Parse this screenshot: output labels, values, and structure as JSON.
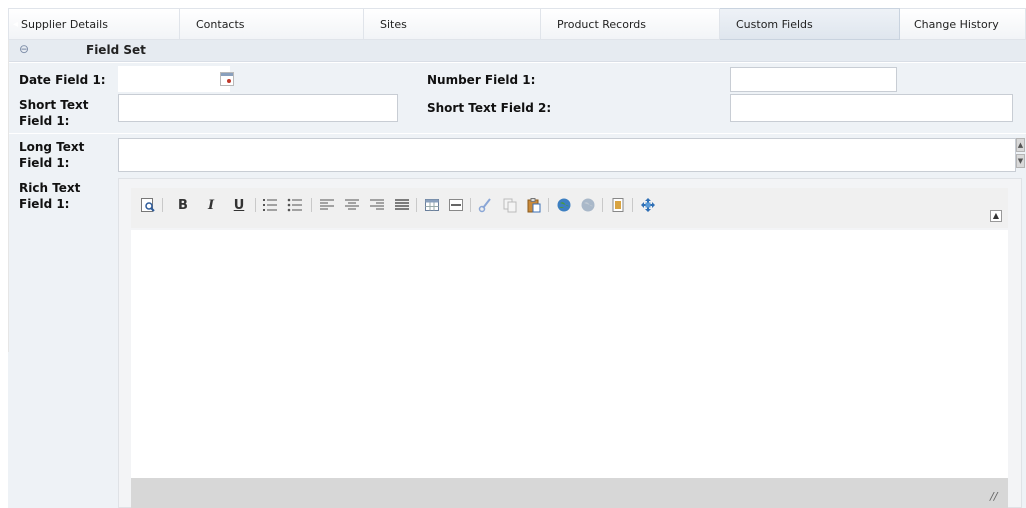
{
  "tabs": [
    {
      "label": "Supplier Details",
      "active": false
    },
    {
      "label": "Contacts",
      "active": false
    },
    {
      "label": "Sites",
      "active": false
    },
    {
      "label": "Product Records",
      "active": false
    },
    {
      "label": "Custom Fields",
      "active": true
    },
    {
      "label": "Change History",
      "active": false
    }
  ],
  "field_set": {
    "title": "Field Set"
  },
  "fields": {
    "date_field_1": {
      "label": "Date Field 1:",
      "value": ""
    },
    "number_field_1": {
      "label": "Number Field 1:",
      "value": ""
    },
    "short_text_field_1": {
      "label": "Short Text Field 1:",
      "value": ""
    },
    "short_text_field_2": {
      "label": "Short Text Field 2:",
      "value": ""
    },
    "long_text_field_1": {
      "label": "Long Text Field 1:",
      "value": ""
    },
    "rich_text_field_1": {
      "label": "Rich Text Field 1:",
      "value": ""
    }
  },
  "rte_toolbar": {
    "bold": "B",
    "italic": "I",
    "underline": "U"
  },
  "colors": {
    "tab_active_bg": "#dfe6ee",
    "fieldset_header_bg": "#e6ebf1",
    "row_bg": "#eef2f6",
    "editor_status_bg": "#d7d7d7"
  },
  "icons": {
    "tab_back": "back-arrow-icon",
    "fieldset_toggle": "collapse-minus-icon",
    "date_picker": "calendar-icon",
    "editor_collapse": "collapse-icon",
    "editor_resize": "resize-grip-icon"
  }
}
